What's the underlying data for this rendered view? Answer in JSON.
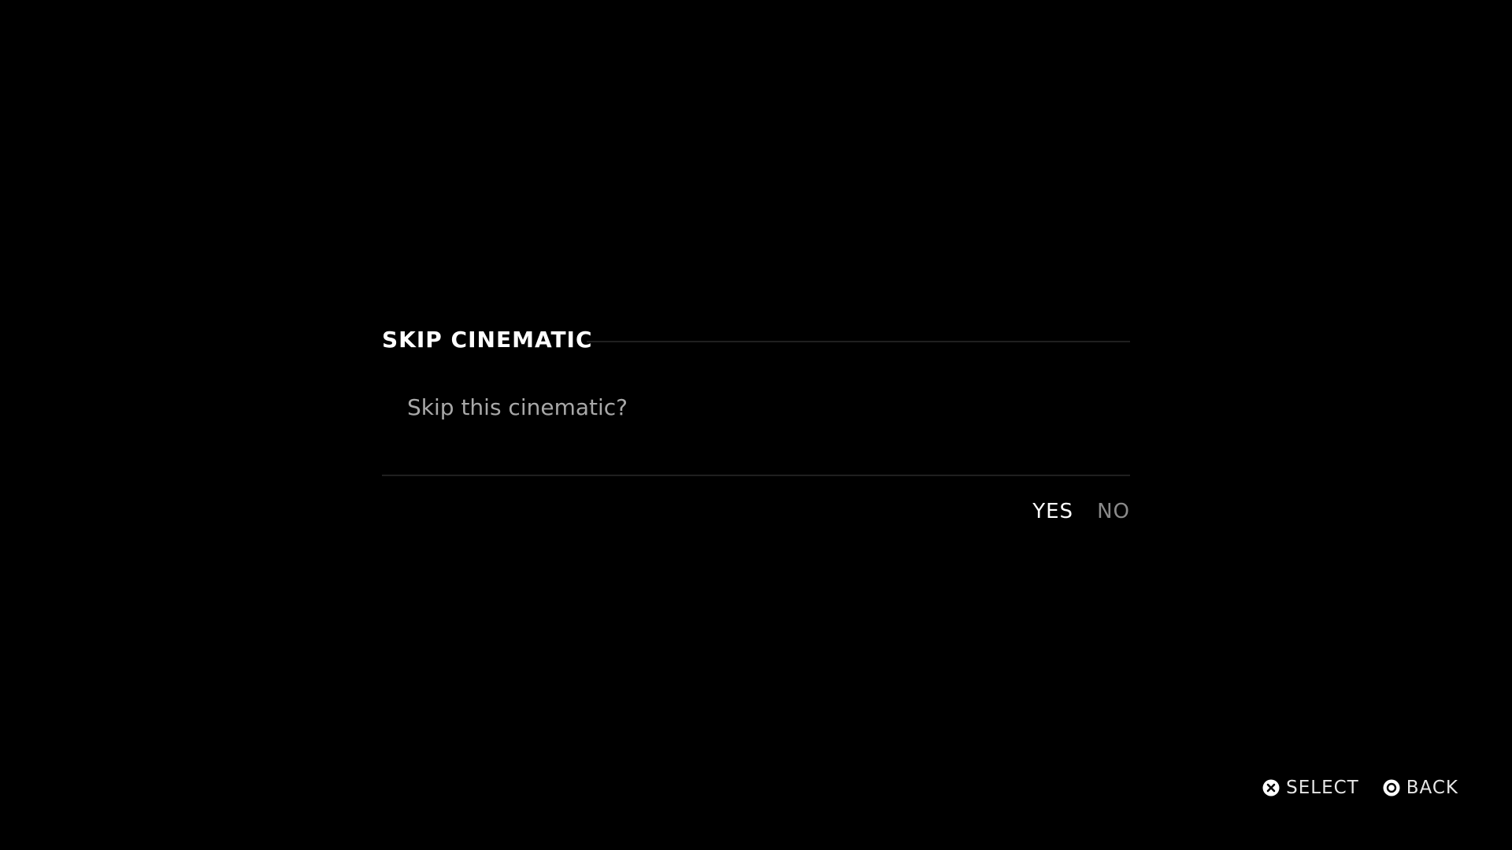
{
  "dialog": {
    "title": "SKIP CINEMATIC",
    "message": "Skip this cinematic?",
    "options": [
      {
        "label": "YES",
        "selected": true
      },
      {
        "label": "NO",
        "selected": false
      }
    ]
  },
  "button_prompts": [
    {
      "icon": "cross-button-icon",
      "label": "SELECT"
    },
    {
      "icon": "circle-button-icon",
      "label": "BACK"
    }
  ],
  "colors": {
    "background": "#000000",
    "text_primary": "#ffffff",
    "text_secondary": "#a8a8a8",
    "text_unselected": "#8a8a8a",
    "rule": "#1f1f1f"
  }
}
